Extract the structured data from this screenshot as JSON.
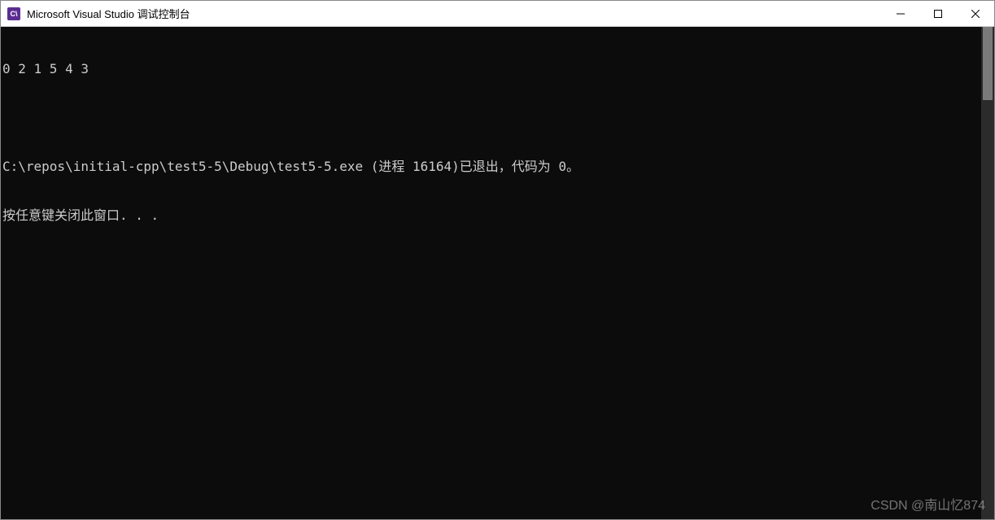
{
  "window": {
    "icon_text": "C\\",
    "title": "Microsoft Visual Studio 调试控制台"
  },
  "console": {
    "lines": [
      "0 2 1 5 4 3",
      "",
      "C:\\repos\\initial-cpp\\test5-5\\Debug\\test5-5.exe (进程 16164)已退出，代码为 0。",
      "按任意键关闭此窗口. . ."
    ]
  },
  "watermark": "CSDN @南山忆874"
}
